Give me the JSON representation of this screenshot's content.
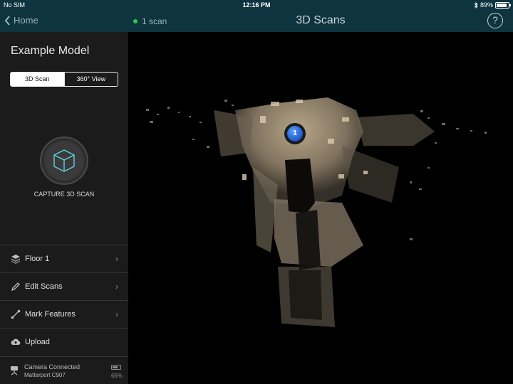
{
  "status_bar": {
    "carrier": "No SIM",
    "time": "12:16 PM",
    "battery": "89%",
    "battery_level": 0.89
  },
  "nav": {
    "back_label": "Home",
    "scan_count": "1 scan",
    "title": "3D Scans",
    "help": "?"
  },
  "sidebar": {
    "model_title": "Example Model",
    "segments": {
      "scan": "3D Scan",
      "view": "360° View",
      "active": "3D Scan"
    },
    "capture_label": "CAPTURE 3D SCAN",
    "menu": [
      {
        "label": "Floor 1",
        "icon": "layers-icon",
        "chevron": true
      },
      {
        "label": "Edit Scans",
        "icon": "pencil-icon",
        "chevron": true
      },
      {
        "label": "Mark Features",
        "icon": "line-icon",
        "chevron": true
      },
      {
        "label": "Upload",
        "icon": "cloud-upload-icon",
        "chevron": false
      }
    ],
    "camera": {
      "status": "Camera Connected",
      "model": "Matterport C907",
      "battery": "66%",
      "battery_level": 0.66
    }
  },
  "viewport": {
    "scan_marker_label": "1"
  },
  "colors": {
    "navbar": "#0e3440",
    "sidebar": "#1b1b1b",
    "accent_green": "#2ecc40",
    "marker_blue": "#1a56c8",
    "pointcloud": "#b8a88a"
  }
}
